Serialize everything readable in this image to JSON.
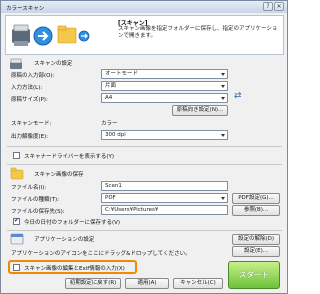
{
  "window": {
    "title": "カラースキャン"
  },
  "header": {
    "title": "[スキャン]",
    "description": "スキャン画像を指定フォルダーに保存し、指定のアプリケーションで開きます。"
  },
  "scan_settings": {
    "section_label": "スキャンの設定",
    "paper_source_label": "原稿の入力部(O):",
    "paper_source_value": "オートモード",
    "duplex_label": "入力方法(L):",
    "duplex_value": "片面",
    "paper_size_label": "原稿サイズ(P):",
    "paper_size_value": "A4",
    "detail_button": "原稿向き設定(N)...",
    "scan_mode_label": "スキャンモード:",
    "scan_mode_value": "カラー",
    "resolution_label": "出力解像度(E):",
    "resolution_value": "300 dpi",
    "show_driver_label": "スキャナードライバーを表示する(Y)"
  },
  "save_settings": {
    "section_label": "スキャン画像の保存",
    "filename_label": "ファイル名(I):",
    "filename_value": "Scan1",
    "filetype_label": "ファイルの種類(T):",
    "filetype_value": "PDF",
    "pdf_settings_button": "PDF設定(G)...",
    "save_location_label": "ファイルの保存先(S):",
    "save_location_value": "C:¥Users¥Pictures¥",
    "browse_button": "参照(B)...",
    "subfolder_label": "今日の日付のフォルダーに保存する(V)"
  },
  "app_settings": {
    "section_label": "アプリケーションの設定",
    "description": "アプリケーションのアイコンをここにドラッグ&ドロップしてください。",
    "cancel_setting_button": "設定の解除(D)",
    "setting_button": "設定(E)..."
  },
  "exif_checkbox_label": "スキャン画像の編集とExif情報の入力(X)",
  "buttons": {
    "restore_defaults": "初期設定に戻す(R)",
    "apply": "適用(A)",
    "cancel": "キャンセル(C)",
    "start": "スタート"
  },
  "checks": {
    "show_driver": false,
    "subfolder": true,
    "exif": false
  },
  "colors": {
    "highlight": "#f08a00",
    "start_green": "#6cc238",
    "swap_blue": "#2a6ab8"
  }
}
